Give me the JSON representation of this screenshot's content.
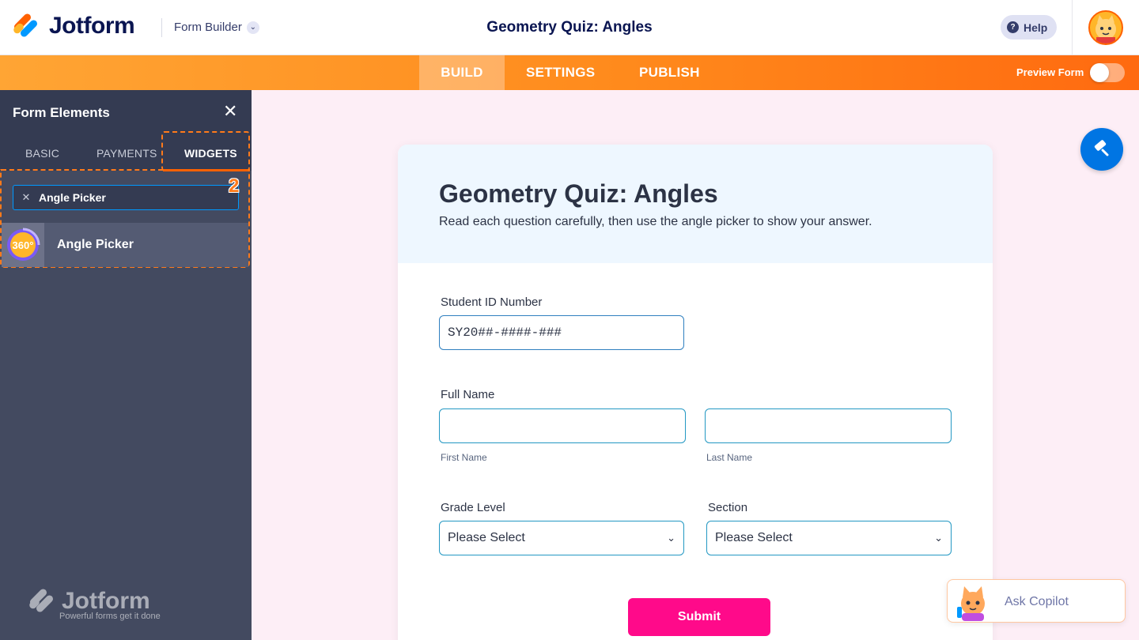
{
  "header": {
    "brand": "Jotform",
    "form_builder": "Form Builder",
    "title": "Geometry Quiz: Angles",
    "help": "Help"
  },
  "nav": {
    "tabs": [
      "BUILD",
      "SETTINGS",
      "PUBLISH"
    ],
    "active_tab": "BUILD",
    "preview_label": "Preview Form",
    "preview_on": false
  },
  "sidebar": {
    "title": "Form Elements",
    "tabs": [
      "BASIC",
      "PAYMENTS",
      "WIDGETS"
    ],
    "active_tab": "WIDGETS",
    "search_value": "Angle Picker",
    "step_badge": "2",
    "results": [
      {
        "label": "Angle Picker",
        "icon": "360-icon",
        "icon_text": "360°"
      }
    ],
    "footer_brand": "Jotform",
    "footer_tagline": "Powerful forms get it done"
  },
  "form": {
    "title": "Geometry Quiz: Angles",
    "subtitle": "Read each question carefully, then use the angle picker to show your answer.",
    "student_id": {
      "label": "Student ID Number",
      "value": "SY20##-####-###"
    },
    "full_name": {
      "label": "Full Name",
      "first_sublabel": "First Name",
      "last_sublabel": "Last Name",
      "first_value": "",
      "last_value": ""
    },
    "grade_level": {
      "label": "Grade Level",
      "selected": "Please Select"
    },
    "section": {
      "label": "Section",
      "selected": "Please Select"
    },
    "submit": "Submit"
  },
  "copilot": {
    "label": "Ask Copilot"
  },
  "colors": {
    "brand_navy": "#0a1551",
    "nav_orange": "#ff8a1c",
    "sidebar_bg": "#434a60",
    "canvas_bg": "#fdeef6",
    "submit_pink": "#ff0a8a",
    "accent_blue": "#0075e3"
  }
}
